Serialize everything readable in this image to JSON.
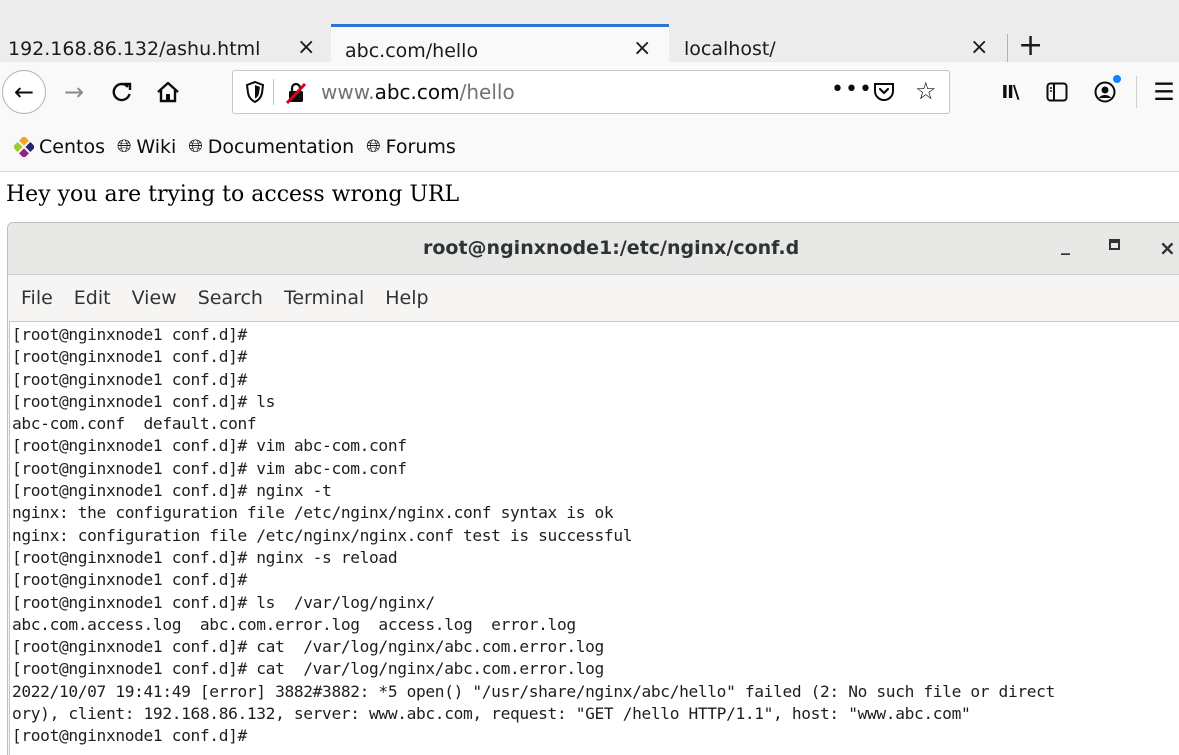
{
  "tabs": [
    {
      "title": "192.168.86.132/ashu.html",
      "close": "×"
    },
    {
      "title": "abc.com/hello",
      "close": "×"
    },
    {
      "title": "localhost/",
      "close": "×"
    }
  ],
  "new_tab_label": "+",
  "nav": {
    "back": "←",
    "forward": "→",
    "reload": "C",
    "url_prefix": "www.",
    "url_host": "abc.com",
    "url_path": "/hello",
    "page_actions": "•••",
    "star": "☆",
    "library": "II\\",
    "menu": "☰"
  },
  "bookmarks": [
    {
      "label": "Centos",
      "icon": "centos-logo-icon"
    },
    {
      "label": "Wiki",
      "icon": "globe-icon"
    },
    {
      "label": "Documentation",
      "icon": "globe-icon"
    },
    {
      "label": "Forums",
      "icon": "globe-icon"
    }
  ],
  "page": {
    "message": "Hey you are trying to access wrong URL"
  },
  "terminal": {
    "title": "root@nginxnode1:/etc/nginx/conf.d",
    "minimize": "_",
    "close": "×",
    "menu": [
      "File",
      "Edit",
      "View",
      "Search",
      "Terminal",
      "Help"
    ],
    "lines": [
      "[root@nginxnode1 conf.d]#",
      "[root@nginxnode1 conf.d]#",
      "[root@nginxnode1 conf.d]#",
      "[root@nginxnode1 conf.d]# ls",
      "abc-com.conf  default.conf",
      "[root@nginxnode1 conf.d]# vim abc-com.conf",
      "[root@nginxnode1 conf.d]# vim abc-com.conf",
      "[root@nginxnode1 conf.d]# nginx -t",
      "nginx: the configuration file /etc/nginx/nginx.conf syntax is ok",
      "nginx: configuration file /etc/nginx/nginx.conf test is successful",
      "[root@nginxnode1 conf.d]# nginx -s reload",
      "[root@nginxnode1 conf.d]#",
      "[root@nginxnode1 conf.d]# ls  /var/log/nginx/",
      "abc.com.access.log  abc.com.error.log  access.log  error.log",
      "[root@nginxnode1 conf.d]# cat  /var/log/nginx/abc.com.error.log",
      "[root@nginxnode1 conf.d]# cat  /var/log/nginx/abc.com.error.log",
      "2022/10/07 19:41:49 [error] 3882#3882: *5 open() \"/usr/share/nginx/abc/hello\" failed (2: No such file or direct",
      "ory), client: 192.168.86.132, server: www.abc.com, request: \"GET /hello HTTP/1.1\", host: \"www.abc.com\"",
      "[root@nginxnode1 conf.d]#"
    ]
  },
  "colors": {
    "active_tab_accent": "#2e73d6",
    "account_badge": "#0a84ff",
    "insecure_strike": "#d70022"
  }
}
